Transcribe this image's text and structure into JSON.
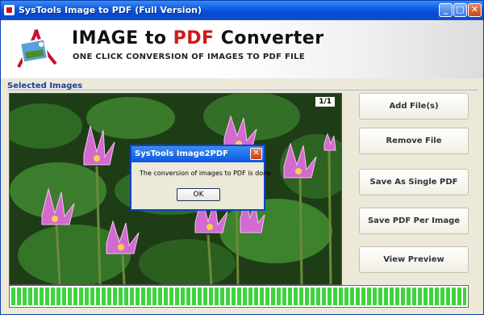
{
  "window": {
    "title": "SysTools Image to PDF (Full Version)"
  },
  "header": {
    "title_part1": "IMAGE to ",
    "title_part2": "PDF",
    "title_part3": " Converter",
    "subtitle": "ONE CLICK CONVERSION OF IMAGES TO PDF FILE"
  },
  "section": {
    "label": "Selected Images"
  },
  "image": {
    "counter": "1/1"
  },
  "buttons": {
    "add": "Add File(s)",
    "remove": "Remove File",
    "single": "Save As Single PDF",
    "per_image": "Save PDF Per Image",
    "preview": "View Preview"
  },
  "progress": {
    "value_percent": 100,
    "color": "#3fd33f"
  },
  "dialog": {
    "title": "SysTools Image2PDF",
    "message": "The conversion of images to PDF is done.",
    "ok": "OK"
  },
  "colors": {
    "accent_red": "#d01818",
    "titlebar_blue": "#0b57e3"
  }
}
